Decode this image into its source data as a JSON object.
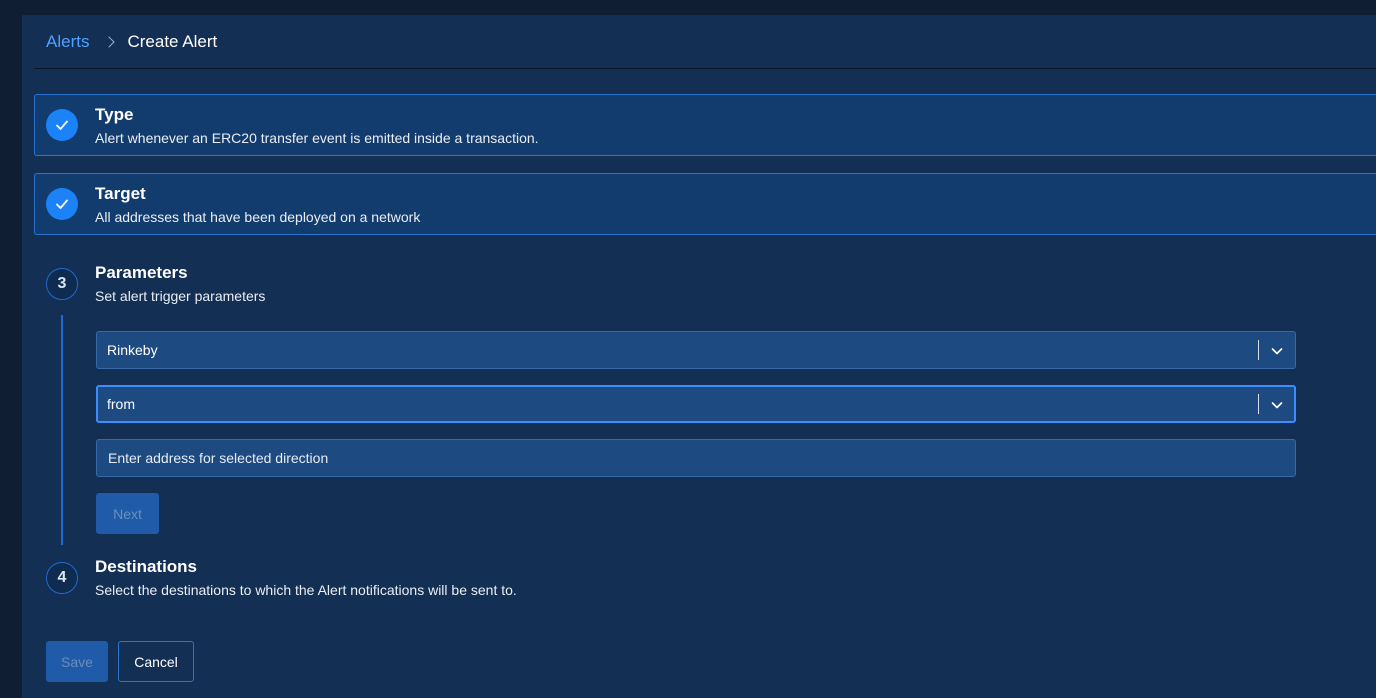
{
  "breadcrumb": {
    "parent": "Alerts",
    "current": "Create Alert"
  },
  "steps": [
    {
      "status": "completed",
      "title": "Type",
      "description": "Alert whenever an ERC20 transfer event is emitted inside a transaction."
    },
    {
      "status": "completed",
      "title": "Target",
      "description": "All addresses that have been deployed on a network"
    },
    {
      "status": "active",
      "number": "3",
      "title": "Parameters",
      "description": "Set alert trigger parameters"
    },
    {
      "status": "pending",
      "number": "4",
      "title": "Destinations",
      "description": "Select the destinations to which the Alert notifications will be sent to."
    }
  ],
  "parameters": {
    "network_select": {
      "value": "Rinkeby"
    },
    "direction_select": {
      "value": "from"
    },
    "address_input": {
      "value": "",
      "placeholder": "Enter address for selected direction"
    },
    "next_label": "Next"
  },
  "footer": {
    "save_label": "Save",
    "cancel_label": "Cancel"
  },
  "colors": {
    "background": "#0f1e33",
    "panel": "#132f53",
    "card": "#133c6e",
    "accent": "#1b82f8",
    "link": "#4fa1ff",
    "input": "#1e4a82"
  },
  "icons": {
    "completed_step": "check-icon",
    "select_toggle": "chevron-down-icon",
    "breadcrumb_separator": "chevron-right-icon"
  }
}
